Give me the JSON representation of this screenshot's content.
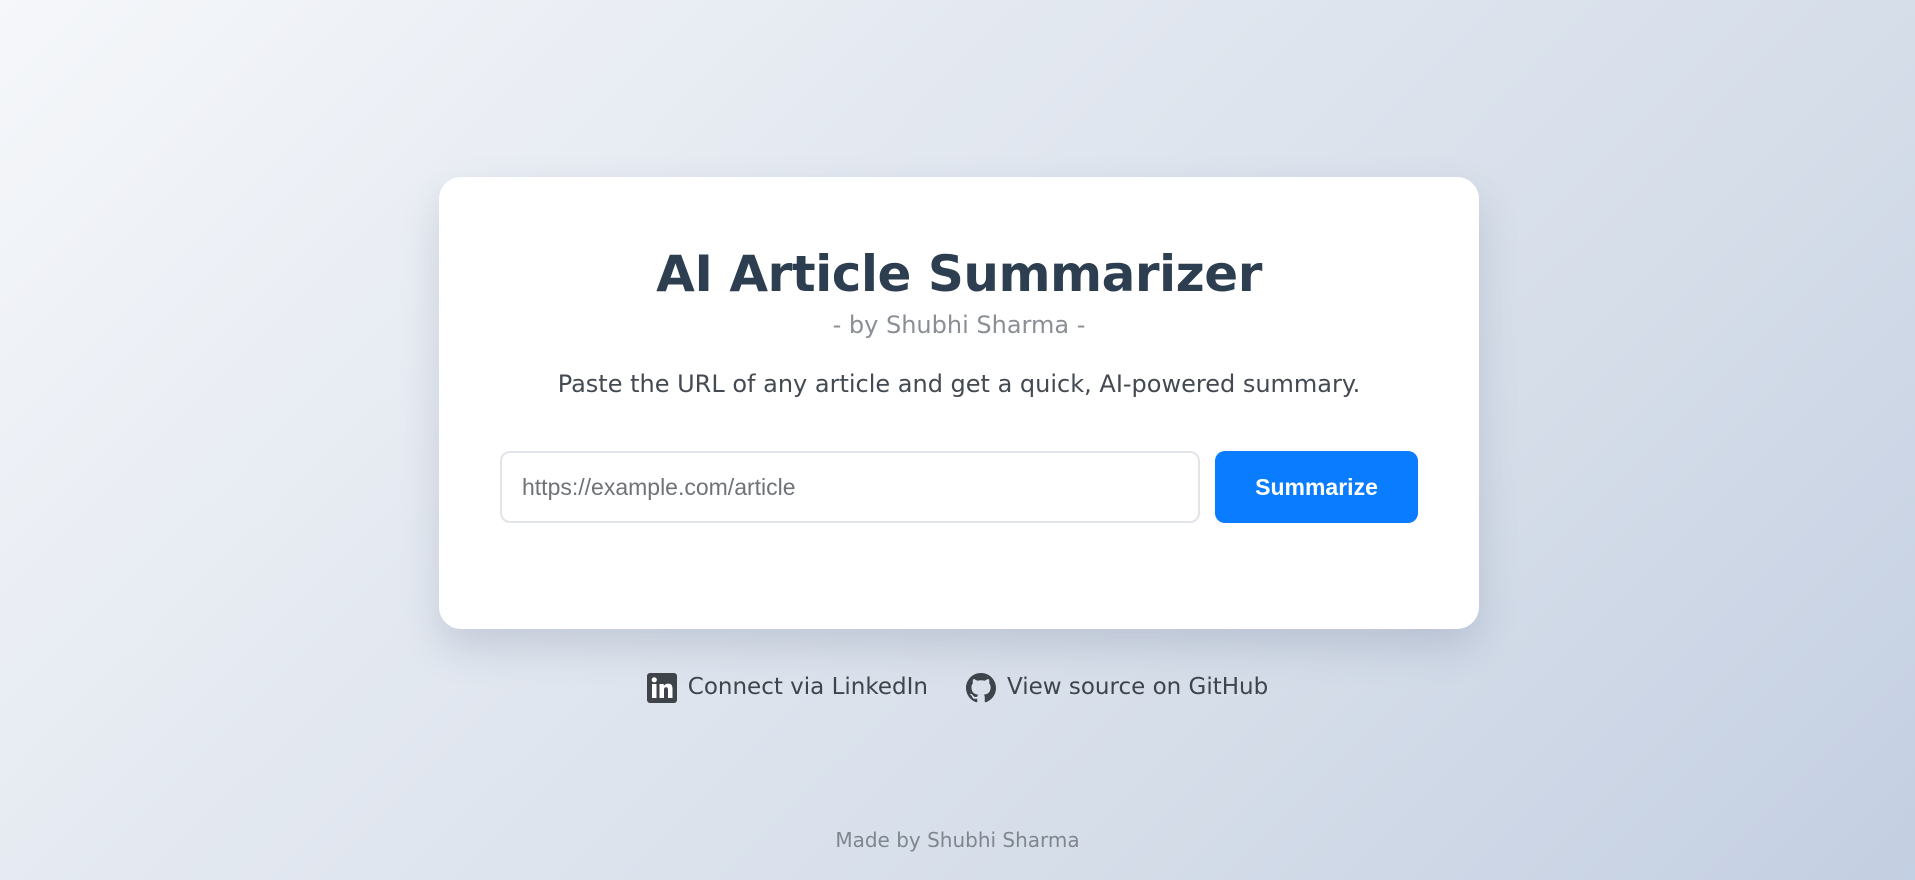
{
  "header": {
    "title": "AI Article Summarizer",
    "byline": "- by Shubhi Sharma -",
    "tagline": "Paste the URL of any article and get a quick, AI-powered summary."
  },
  "form": {
    "url_input": {
      "value": "",
      "placeholder": "https://example.com/article"
    },
    "submit_label": "Summarize"
  },
  "links": {
    "linkedin": {
      "label": "Connect via LinkedIn",
      "icon": "linkedin-icon"
    },
    "github": {
      "label": "View source on GitHub",
      "icon": "github-icon"
    }
  },
  "footer": {
    "text": "Made by Shubhi Sharma"
  },
  "colors": {
    "accent": "#0a7cff",
    "title": "#2c3e50",
    "card_background": "#ffffff"
  }
}
